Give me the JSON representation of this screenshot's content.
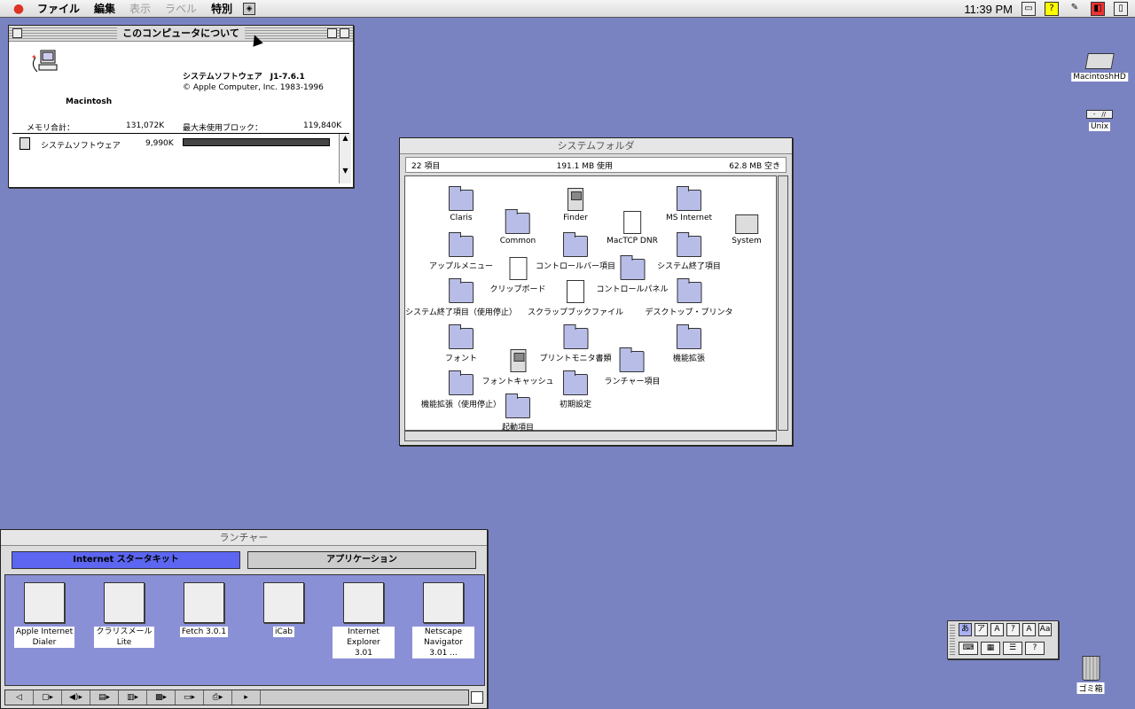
{
  "menubar": {
    "items": [
      "ファイル",
      "編集",
      "表示",
      "ラベル",
      "特別"
    ],
    "disabled": [
      false,
      false,
      true,
      true,
      false
    ],
    "clock": "11:39 PM"
  },
  "about": {
    "title": "このコンピュータについて",
    "machine": "Macintosh",
    "system_software": "システムソフトウェア　J1-7.6.1",
    "copyright": "© Apple Computer, Inc. 1983-1996",
    "memory_total_label": "メモリ合計：",
    "memory_total_value": "131,072K",
    "largest_block_label": "最大未使用ブロック：",
    "largest_block_value": "119,840K",
    "apps": [
      {
        "name": "システムソフトウェア",
        "size": "9,990K",
        "usage": 1.0
      }
    ]
  },
  "system_folder": {
    "title": "システムフォルダ",
    "items_count": "22 項目",
    "used": "191.1 MB 使用",
    "free": "62.8 MB 空き",
    "items": [
      {
        "label": "Claris",
        "kind": "folder"
      },
      {
        "label": "Finder",
        "kind": "mac"
      },
      {
        "label": "MS Internet",
        "kind": "folder"
      },
      {
        "label": "Common",
        "kind": "folder"
      },
      {
        "label": "MacTCP DNR",
        "kind": "doc"
      },
      {
        "label": "System",
        "kind": "suitcase"
      },
      {
        "label": "アップルメニュー",
        "kind": "folder"
      },
      {
        "label": "コントロールバー項目",
        "kind": "folder"
      },
      {
        "label": "システム終了項目",
        "kind": "folder"
      },
      {
        "label": "クリップボード",
        "kind": "doc"
      },
      {
        "label": "コントロールパネル",
        "kind": "folder"
      },
      {
        "label": "システム終了項目（使用停止）",
        "kind": "folder"
      },
      {
        "label": "スクラップブックファイル",
        "kind": "doc"
      },
      {
        "label": "デスクトップ・プリンタ",
        "kind": "folder"
      },
      {
        "label": "フォント",
        "kind": "folder"
      },
      {
        "label": "プリントモニタ書類",
        "kind": "folder"
      },
      {
        "label": "機能拡張",
        "kind": "folder"
      },
      {
        "label": "フォントキャッシュ",
        "kind": "mac"
      },
      {
        "label": "ランチャー項目",
        "kind": "folder"
      },
      {
        "label": "機能拡張（使用停止）",
        "kind": "folder"
      },
      {
        "label": "初期設定",
        "kind": "folder"
      },
      {
        "label": "起動項目",
        "kind": "folder"
      }
    ]
  },
  "launcher": {
    "title": "ランチャー",
    "tabs": [
      "Internet スタータキット",
      "アプリケーション"
    ],
    "items": [
      {
        "label1": "Apple Internet",
        "label2": "Dialer",
        "icon": "phone-globe-icon"
      },
      {
        "label1": "クラリスメール",
        "label2": "Lite",
        "icon": "mail-icon"
      },
      {
        "label1": "Fetch 3.0.1",
        "label2": "",
        "icon": "dog-icon"
      },
      {
        "label1": "iCab",
        "label2": "",
        "icon": "car-icon"
      },
      {
        "label1": "Internet Explorer",
        "label2": "3.01",
        "icon": "globe-icon"
      },
      {
        "label1": "Netscape",
        "label2": "Navigator 3.01 ...",
        "icon": "wheel-icon"
      }
    ]
  },
  "desktop": {
    "hd": "MacintoshHD",
    "unix": "Unix",
    "trash": "ゴミ箱"
  },
  "palette": {
    "row1": [
      "あ",
      "ア",
      "A",
      "ｱ",
      "A",
      "Aa"
    ],
    "row2": [
      "⌨",
      "▦",
      "☰",
      "?"
    ]
  }
}
